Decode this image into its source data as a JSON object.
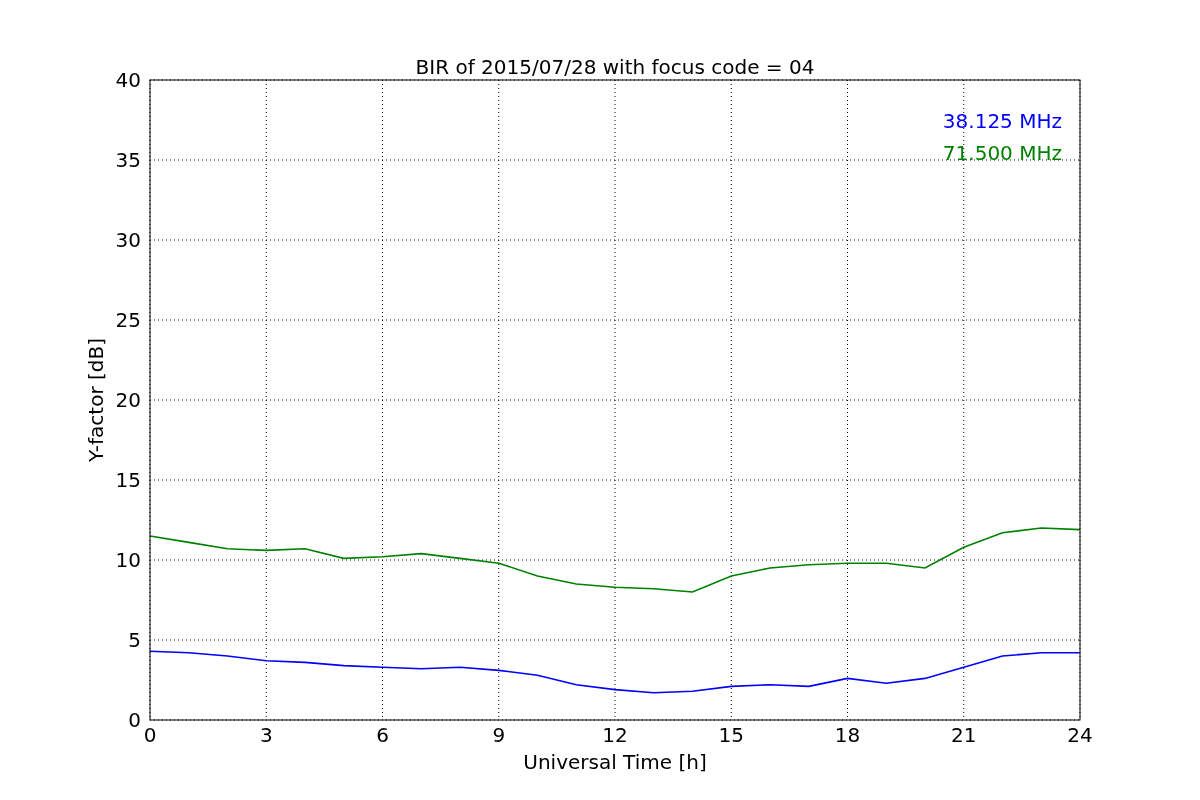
{
  "chart_data": {
    "type": "line",
    "title": "BIR of 2015/07/28 with focus code = 04",
    "xlabel": "Universal Time [h]",
    "ylabel": "Y-factor [dB]",
    "x": [
      0,
      1,
      2,
      3,
      4,
      5,
      6,
      7,
      8,
      9,
      10,
      11,
      12,
      13,
      14,
      15,
      16,
      17,
      18,
      19,
      20,
      21,
      22,
      23,
      24
    ],
    "series": [
      {
        "name": "38.125 MHz",
        "color": "#0000ff",
        "values": [
          4.3,
          4.2,
          4.0,
          3.7,
          3.6,
          3.4,
          3.3,
          3.2,
          3.3,
          3.1,
          2.8,
          2.2,
          1.9,
          1.7,
          1.8,
          2.1,
          2.2,
          2.1,
          2.6,
          2.3,
          2.6,
          3.3,
          4.0,
          4.2,
          4.2
        ]
      },
      {
        "name": "71.500 MHz",
        "color": "#008000",
        "values": [
          11.5,
          11.1,
          10.7,
          10.6,
          10.7,
          10.1,
          10.2,
          10.4,
          10.1,
          9.8,
          9.0,
          8.5,
          8.3,
          8.2,
          8.0,
          9.0,
          9.5,
          9.7,
          9.8,
          9.8,
          9.5,
          10.8,
          11.7,
          12.0,
          11.9
        ]
      }
    ],
    "xlim": [
      0,
      24
    ],
    "ylim": [
      0,
      40
    ],
    "xticks": [
      0,
      3,
      6,
      9,
      12,
      15,
      18,
      21,
      24
    ],
    "yticks": [
      0,
      5,
      10,
      15,
      20,
      25,
      30,
      35,
      40
    ],
    "grid": true
  }
}
